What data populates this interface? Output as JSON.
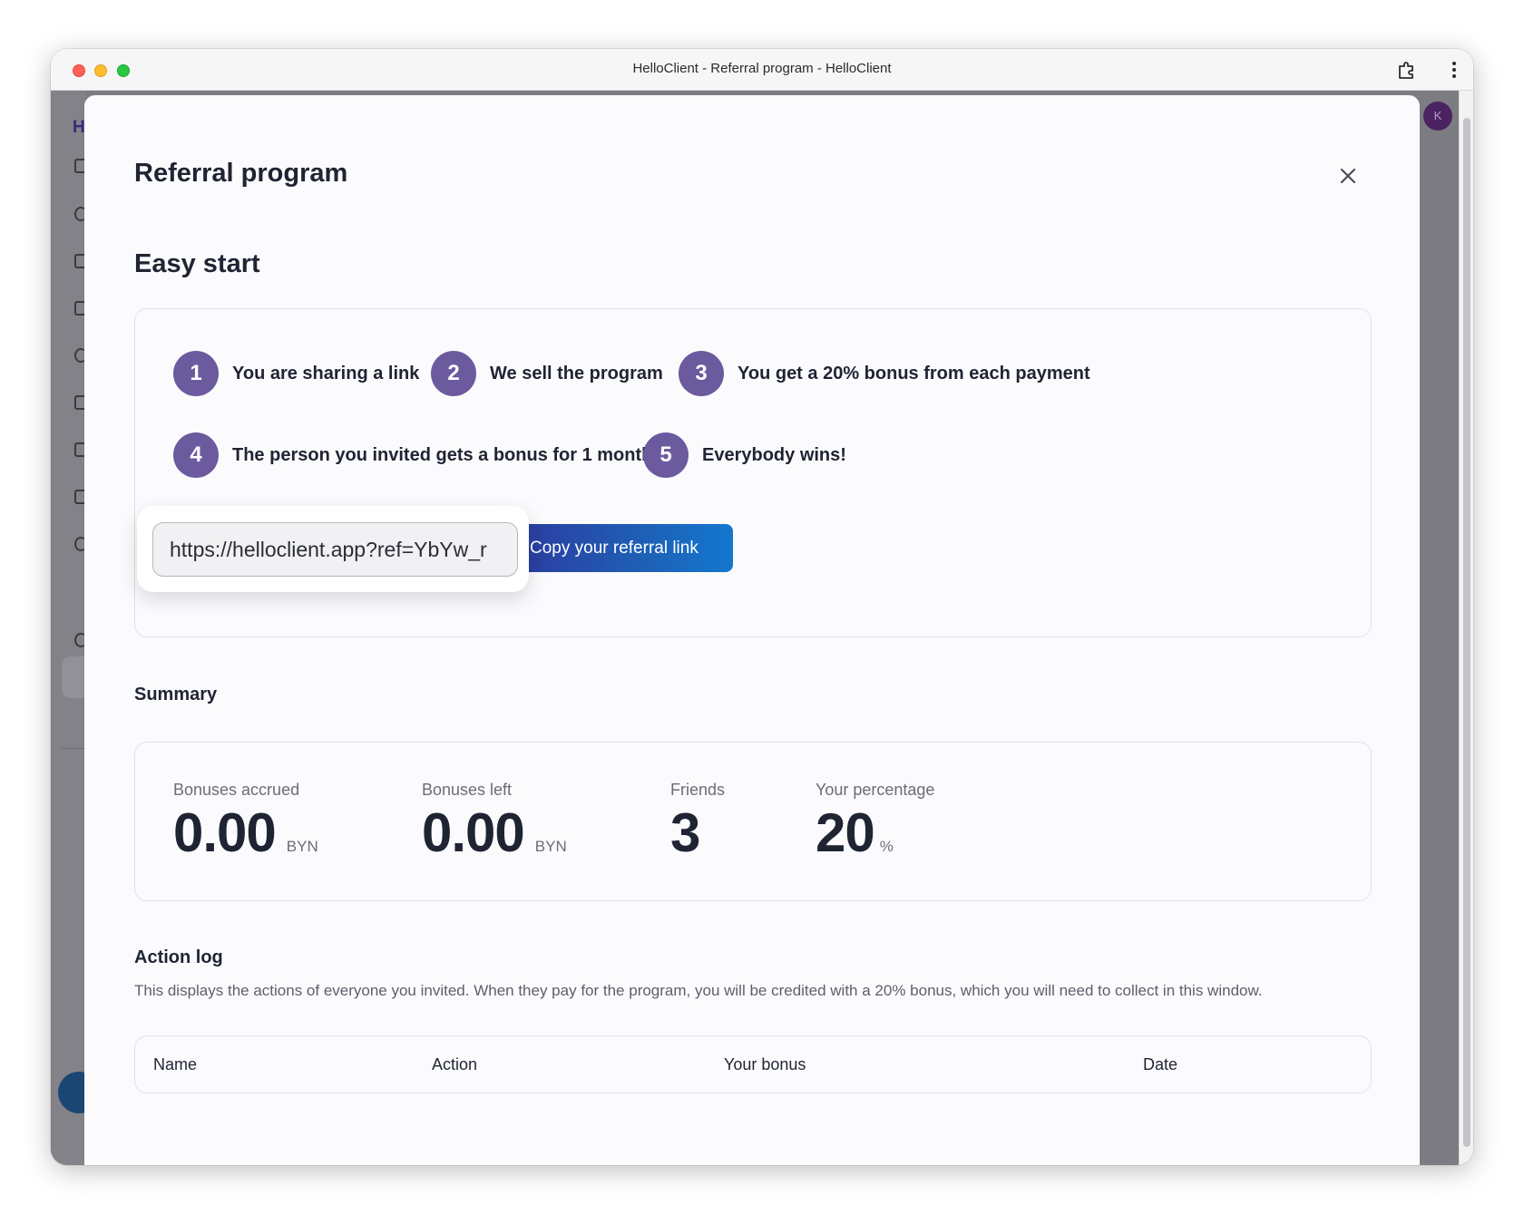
{
  "window": {
    "title": "HelloClient - Referral program - HelloClient"
  },
  "background": {
    "sidebar_letter": "H",
    "avatar_initial": "K"
  },
  "modal": {
    "title": "Referral program",
    "easy_start": {
      "title": "Easy start",
      "steps": [
        {
          "number": "1",
          "label": "You are sharing a link"
        },
        {
          "number": "2",
          "label": "We sell the program"
        },
        {
          "number": "3",
          "label": "You get a 20% bonus from each payment"
        },
        {
          "number": "4",
          "label": "The person you invited gets a bonus for 1 month"
        },
        {
          "number": "5",
          "label": "Everybody wins!"
        }
      ],
      "referral_link_value": "https://helloclient.app?ref=YbYw_r",
      "copy_button_label": "Copy your referral link"
    },
    "summary": {
      "title": "Summary",
      "stats": [
        {
          "label": "Bonuses accrued",
          "value": "0.00",
          "unit": "BYN"
        },
        {
          "label": "Bonuses left",
          "value": "0.00",
          "unit": "BYN"
        },
        {
          "label": "Friends",
          "value": "3",
          "unit": ""
        },
        {
          "label": "Your percentage",
          "value": "20",
          "unit": "%"
        }
      ]
    },
    "action_log": {
      "title": "Action log",
      "description": "This displays the actions of everyone you invited. When they pay for the program, you will be credited with a 20% bonus, which you will need to collect in this window.",
      "columns": [
        "Name",
        "Action",
        "Your bonus",
        "Date"
      ]
    }
  },
  "colors": {
    "step_badge": "#6b5a9e",
    "button_gradient_start": "#2b3fa2",
    "button_gradient_end": "#1477cf",
    "backdrop": "#7d7c82"
  },
  "icons": {
    "close": "close-icon",
    "extension": "puzzle-icon",
    "menu": "vertical-ellipsis-icon",
    "chat": "chat-icon"
  }
}
